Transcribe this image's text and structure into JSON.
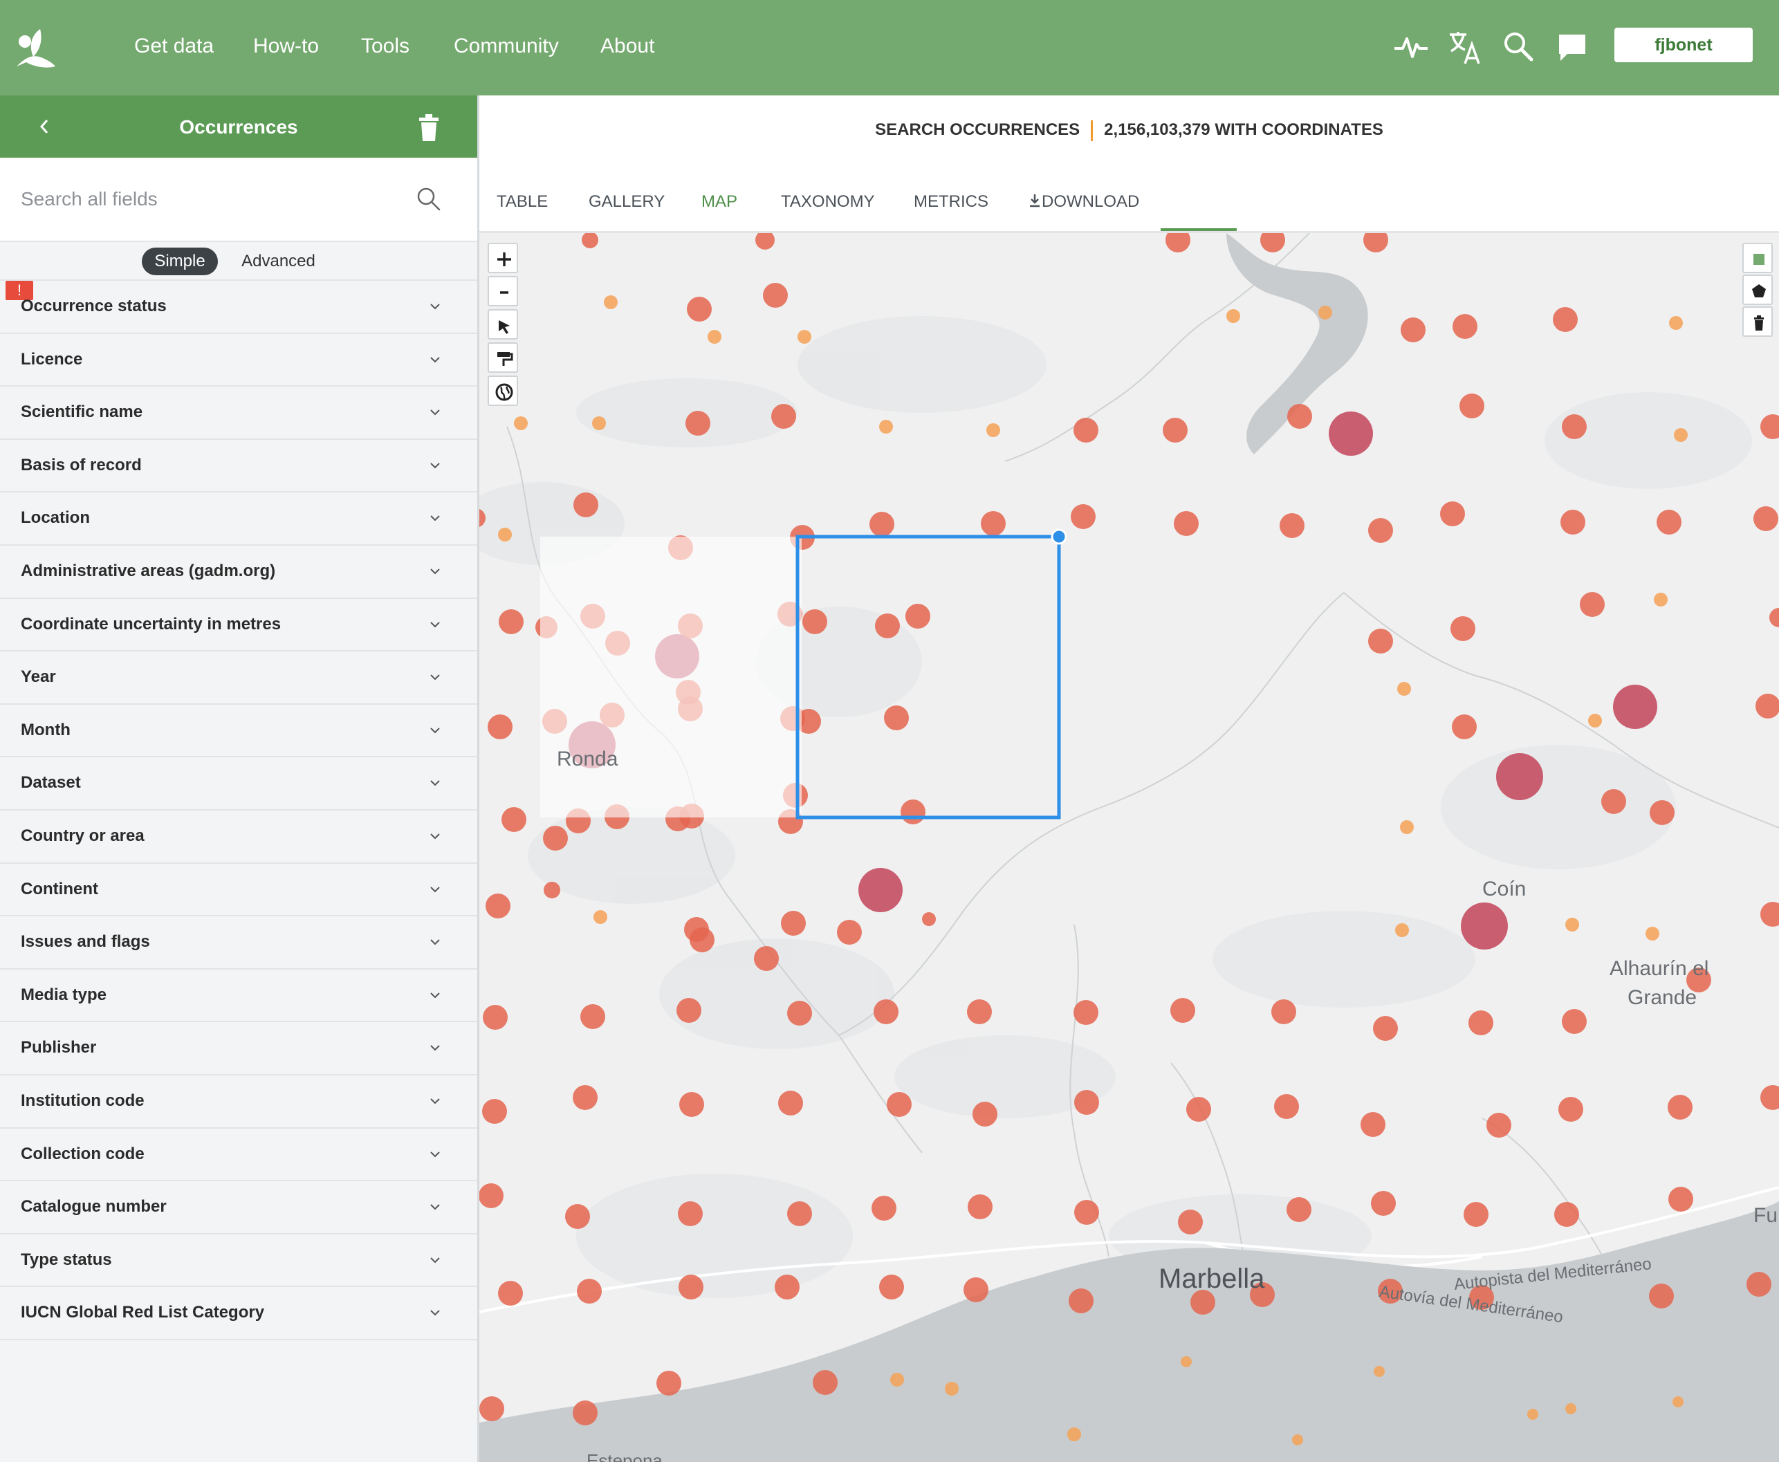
{
  "nav": {
    "links": [
      "Get data",
      "How-to",
      "Tools",
      "Community",
      "About"
    ],
    "icons": [
      "activity-icon",
      "translate-icon",
      "search-icon",
      "feedback-icon"
    ],
    "user": "fjbonet"
  },
  "sidebar": {
    "back_icon": "chevron-left-icon",
    "title": "Occurrences",
    "search_placeholder": "Search all fields",
    "mode_simple": "Simple",
    "mode_advanced": "Advanced",
    "warning_badge": "!",
    "filters": [
      "Occurrence status",
      "Licence",
      "Scientific name",
      "Basis of record",
      "Location",
      "Administrative areas (gadm.org)",
      "Coordinate uncertainty in metres",
      "Year",
      "Month",
      "Dataset",
      "Country or area",
      "Continent",
      "Issues and flags",
      "Media type",
      "Publisher",
      "Institution code",
      "Collection code",
      "Catalogue number",
      "Type status",
      "IUCN Global Red List Category"
    ]
  },
  "main": {
    "search_label": "SEARCH OCCURRENCES",
    "count_label": "2,156,103,379 WITH COORDINATES",
    "tabs": [
      "TABLE",
      "GALLERY",
      "MAP",
      "TAXONOMY",
      "METRICS",
      "DOWNLOAD"
    ],
    "active_tab": "MAP"
  },
  "map": {
    "place_labels": [
      "Ronda",
      "Coín",
      "Alhaurín el",
      "Grande",
      "Marbella",
      "Fu",
      "Estepona"
    ],
    "road_labels": [
      "Autopista del Mediterráneo",
      "Autovía del Mediterráneo"
    ],
    "zoom_in": "+",
    "zoom_out": "-",
    "colors": {
      "dot": "#e4654f",
      "dot_large": "#c3445a",
      "dot_small": "#f5a155",
      "selection": "#2e8fe8",
      "sea": "#c9ccce",
      "land": "#f0f0f0",
      "accent": "#74a96f"
    }
  }
}
